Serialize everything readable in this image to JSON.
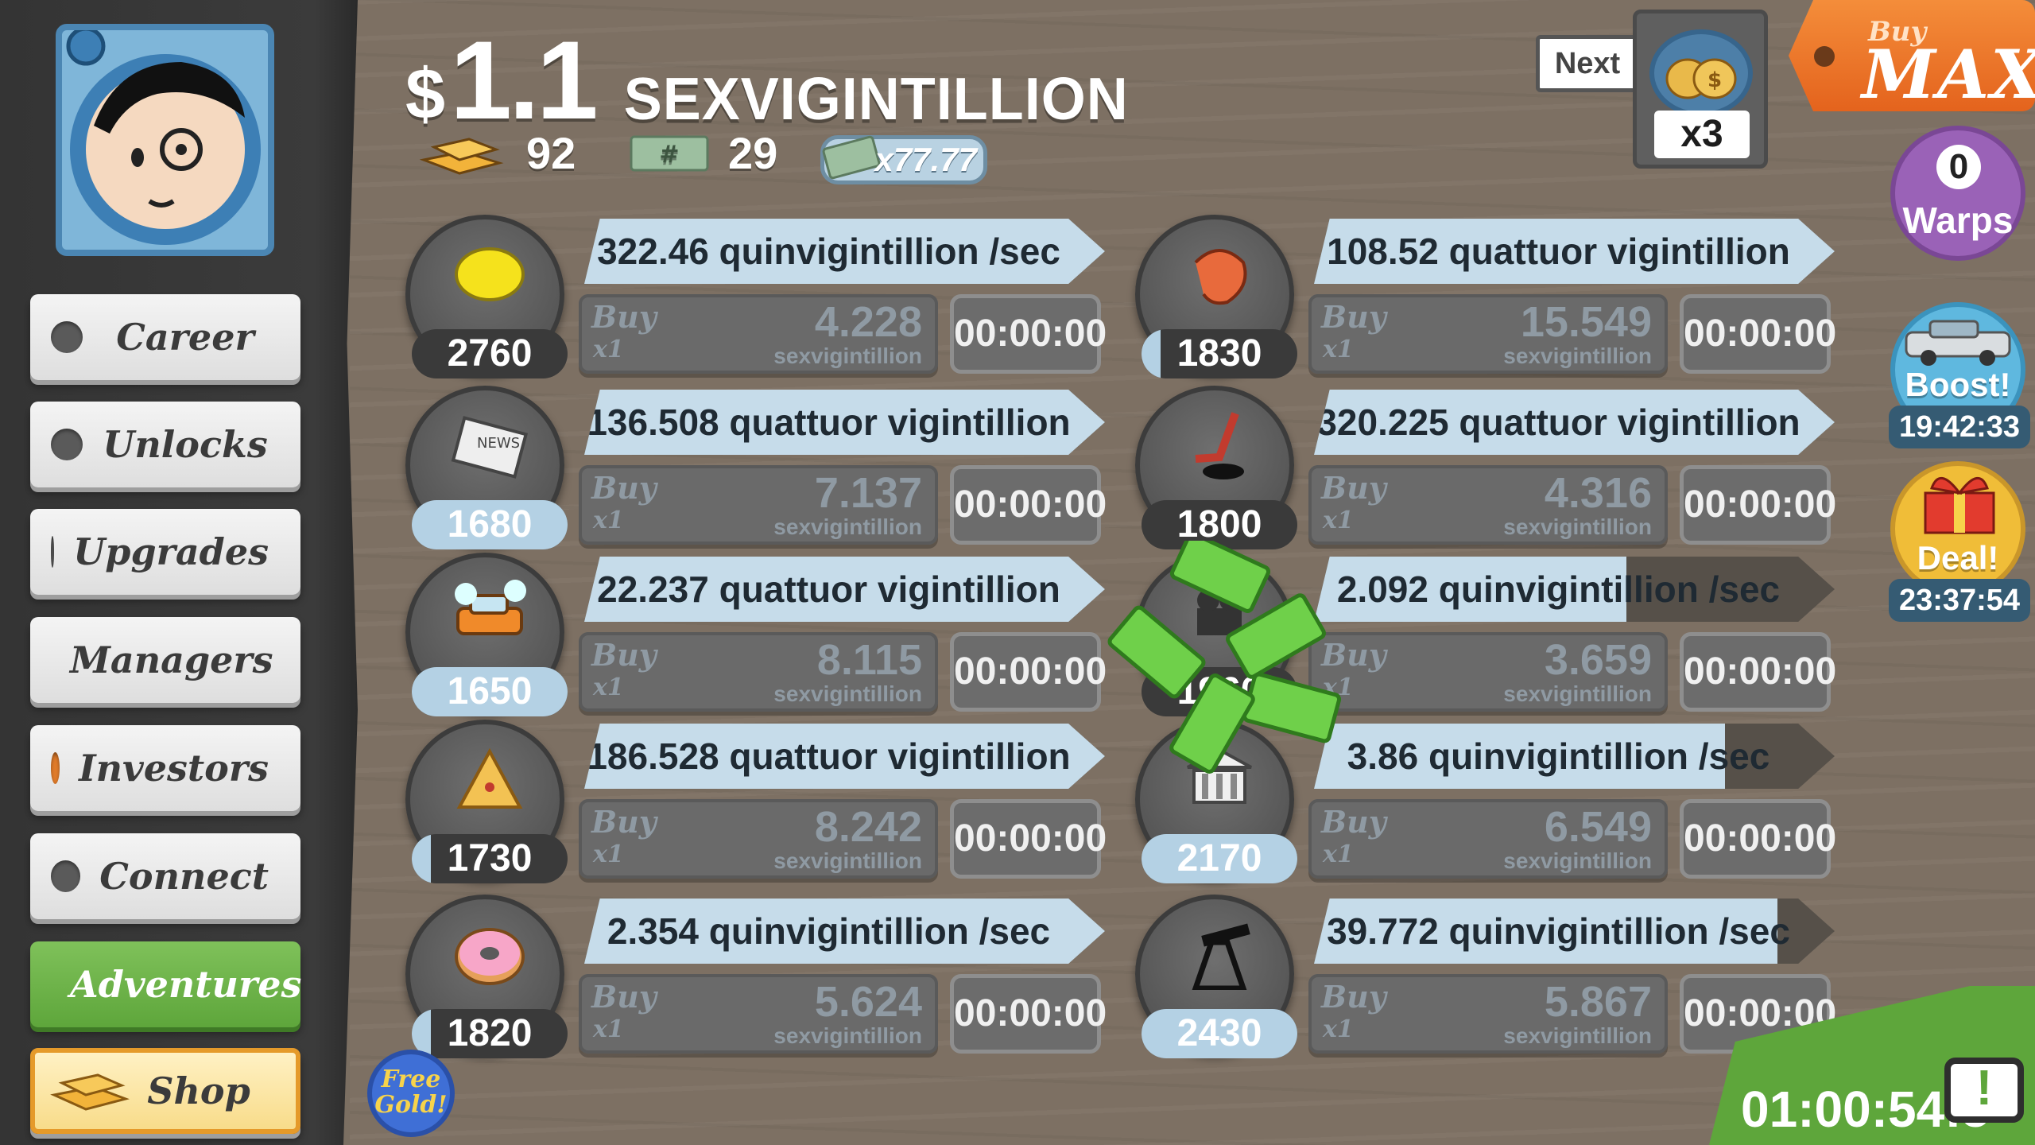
{
  "header": {
    "currency_symbol": "$",
    "money_amount": "1.1",
    "money_unit": "SEXVIGINTILLION",
    "gold_count": "92",
    "megabucks_count": "29",
    "multiplier_ticket": "x77.77"
  },
  "sidebar": {
    "items": [
      {
        "label": "Career"
      },
      {
        "label": "Unlocks"
      },
      {
        "label": "Upgrades"
      },
      {
        "label": "Managers"
      },
      {
        "label": "Investors"
      },
      {
        "label": "Connect"
      },
      {
        "label": "Adventures"
      },
      {
        "label": "Shop"
      }
    ]
  },
  "businesses": [
    {
      "icon": "lemon-icon",
      "count": "2760",
      "count_progress": 0.0,
      "revenue": "322.46 quinvigintillion /sec",
      "revenue_progress": 1.0,
      "buy_label": "Buy",
      "buy_qty": "x1",
      "cost": "4.228",
      "cost_unit": "sexvigintillion",
      "timer": "00:00:00"
    },
    {
      "icon": "shrimp-icon",
      "count": "1830",
      "count_progress": 0.12,
      "revenue": "108.52 quattuor vigintillion /sec",
      "revenue_progress": 1.0,
      "buy_label": "Buy",
      "buy_qty": "x1",
      "cost": "15.549",
      "cost_unit": "sexvigintillion",
      "timer": "00:00:00"
    },
    {
      "icon": "newspaper-icon",
      "count": "1680",
      "count_progress": 1.0,
      "revenue": "136.508 quattuor vigintillion /sec",
      "revenue_progress": 1.0,
      "buy_label": "Buy",
      "buy_qty": "x1",
      "cost": "7.137",
      "cost_unit": "sexvigintillion",
      "timer": "00:00:00"
    },
    {
      "icon": "hockey-icon",
      "count": "1800",
      "count_progress": 0.0,
      "revenue": "320.225 quattuor vigintillion /sec",
      "revenue_progress": 1.0,
      "buy_label": "Buy",
      "buy_qty": "x1",
      "cost": "4.316",
      "cost_unit": "sexvigintillion",
      "timer": "00:00:00"
    },
    {
      "icon": "car-wash-icon",
      "count": "1650",
      "count_progress": 1.0,
      "revenue": "22.237 quattuor vigintillion /sec",
      "revenue_progress": 1.0,
      "buy_label": "Buy",
      "buy_qty": "x1",
      "cost": "8.115",
      "cost_unit": "sexvigintillion",
      "timer": "00:00:00"
    },
    {
      "icon": "movie-camera-icon",
      "count": "1960",
      "count_progress": 0.0,
      "revenue": "2.092 quinvigintillion /sec",
      "revenue_progress": 0.6,
      "buy_label": "Buy",
      "buy_qty": "x1",
      "cost": "3.659",
      "cost_unit": "sexvigintillion",
      "timer": "00:00:00"
    },
    {
      "icon": "pizza-icon",
      "count": "1730",
      "count_progress": 0.12,
      "revenue": "186.528 quattuor vigintillion /sec",
      "revenue_progress": 1.0,
      "buy_label": "Buy",
      "buy_qty": "x1",
      "cost": "8.242",
      "cost_unit": "sexvigintillion",
      "timer": "00:00:00"
    },
    {
      "icon": "bank-icon",
      "count": "2170",
      "count_progress": 1.0,
      "revenue": "3.86 quinvigintillion /sec",
      "revenue_progress": 0.79,
      "buy_label": "Buy",
      "buy_qty": "x1",
      "cost": "6.549",
      "cost_unit": "sexvigintillion",
      "timer": "00:00:00"
    },
    {
      "icon": "donut-icon",
      "count": "1820",
      "count_progress": 0.12,
      "revenue": "2.354 quinvigintillion /sec",
      "revenue_progress": 1.0,
      "buy_label": "Buy",
      "buy_qty": "x1",
      "cost": "5.624",
      "cost_unit": "sexvigintillion",
      "timer": "00:00:00"
    },
    {
      "icon": "oil-rig-icon",
      "count": "2430",
      "count_progress": 1.0,
      "revenue": "39.772 quinvigintillion /sec",
      "revenue_progress": 0.89,
      "buy_label": "Buy",
      "buy_qty": "x1",
      "cost": "5.867",
      "cost_unit": "sexvigintillion",
      "timer": "00:00:00"
    }
  ],
  "controls": {
    "next_label": "Next",
    "multiplier": "x3",
    "buy_max_top": "Buy",
    "buy_max_bottom": "MAX"
  },
  "side": {
    "warps_count": "0",
    "warps_label": "Warps",
    "boost_label": "Boost!",
    "boost_timer": "19:42:33",
    "deal_label": "Deal!",
    "deal_timer": "23:37:54",
    "free_gold_label": "Free Gold!",
    "tv_timer": "01:00:54:5"
  },
  "colors": {
    "accent_orange": "#e4631d",
    "adventures_green": "#5ea63b",
    "revenue_bar": "#c6dcea",
    "investors_dot": "#e07b2a"
  }
}
